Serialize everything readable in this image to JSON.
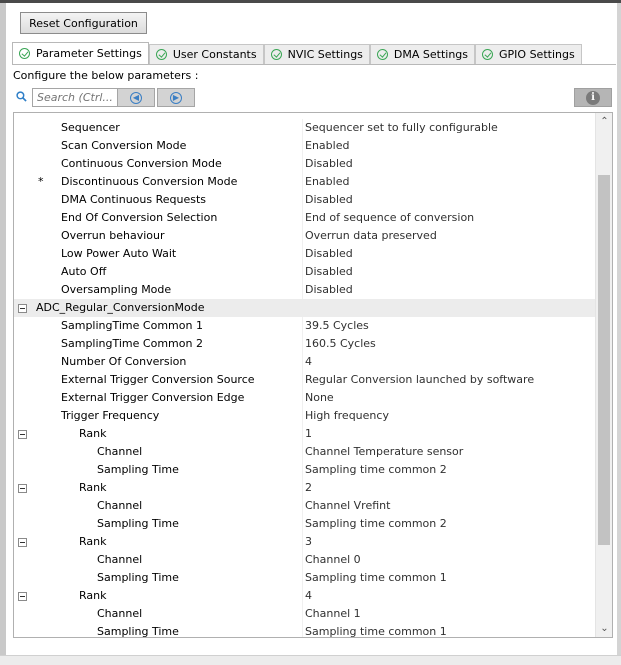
{
  "toolbar": {
    "reset_label": "Reset Configuration"
  },
  "tabs": [
    {
      "label": "Parameter Settings",
      "active": true
    },
    {
      "label": "User Constants",
      "active": false
    },
    {
      "label": "NVIC Settings",
      "active": false
    },
    {
      "label": "DMA Settings",
      "active": false
    },
    {
      "label": "GPIO Settings",
      "active": false
    }
  ],
  "configure_label": "Configure the below parameters :",
  "search": {
    "placeholder": "Search (Ctrl..."
  },
  "icons": {
    "search": "search-icon",
    "prev": "arrow-left-icon",
    "next": "arrow-right-icon",
    "info": "info-icon",
    "collapse": "collapse-icon",
    "tab_check": "check-circle-icon"
  },
  "colors": {
    "check_green": "#3aa655",
    "nav_blue": "#3b7fc4",
    "section_bg": "#ececec"
  },
  "rows": [
    {
      "name": "Sequencer",
      "value": "Sequencer set to fully configurable",
      "indent": 1
    },
    {
      "name": "Scan Conversion Mode",
      "value": "Enabled",
      "indent": 1
    },
    {
      "name": "Continuous Conversion Mode",
      "value": "Disabled",
      "indent": 1
    },
    {
      "name": "Discontinuous Conversion Mode",
      "value": "Enabled",
      "indent": 1,
      "star": "*"
    },
    {
      "name": "DMA Continuous Requests",
      "value": "Disabled",
      "indent": 1
    },
    {
      "name": "End Of Conversion Selection",
      "value": "End of sequence of conversion",
      "indent": 1
    },
    {
      "name": "Overrun behaviour",
      "value": "Overrun data preserved",
      "indent": 1
    },
    {
      "name": "Low Power Auto Wait",
      "value": "Disabled",
      "indent": 1
    },
    {
      "name": "Auto Off",
      "value": "Disabled",
      "indent": 1
    },
    {
      "name": "Oversampling Mode",
      "value": "Disabled",
      "indent": 1
    },
    {
      "name": "ADC_Regular_ConversionMode",
      "value": "",
      "indent": 0,
      "section": true,
      "toggle": true
    },
    {
      "name": "SamplingTime Common 1",
      "value": "39.5 Cycles",
      "indent": 1
    },
    {
      "name": "SamplingTime Common 2",
      "value": "160.5 Cycles",
      "indent": 1
    },
    {
      "name": "Number Of Conversion",
      "value": "4",
      "indent": 1
    },
    {
      "name": "External Trigger Conversion Source",
      "value": "Regular Conversion launched by software",
      "indent": 1
    },
    {
      "name": "External Trigger Conversion Edge",
      "value": "None",
      "indent": 1
    },
    {
      "name": "Trigger Frequency",
      "value": "High frequency",
      "indent": 1
    },
    {
      "name": "Rank",
      "value": "1",
      "indent": 2,
      "toggle": true
    },
    {
      "name": "Channel",
      "value": "Channel Temperature sensor",
      "indent": 3
    },
    {
      "name": "Sampling Time",
      "value": "Sampling time common 2",
      "indent": 3
    },
    {
      "name": "Rank",
      "value": "2",
      "indent": 2,
      "toggle": true
    },
    {
      "name": "Channel",
      "value": "Channel Vrefint",
      "indent": 3
    },
    {
      "name": "Sampling Time",
      "value": "Sampling time common 2",
      "indent": 3
    },
    {
      "name": "Rank",
      "value": "3",
      "indent": 2,
      "toggle": true
    },
    {
      "name": "Channel",
      "value": "Channel 0",
      "indent": 3
    },
    {
      "name": "Sampling Time",
      "value": "Sampling time common 1",
      "indent": 3
    },
    {
      "name": "Rank",
      "value": "4",
      "indent": 2,
      "toggle": true
    },
    {
      "name": "Channel",
      "value": "Channel 1",
      "indent": 3
    },
    {
      "name": "Sampling Time",
      "value": "Sampling time common 1",
      "indent": 3
    }
  ]
}
